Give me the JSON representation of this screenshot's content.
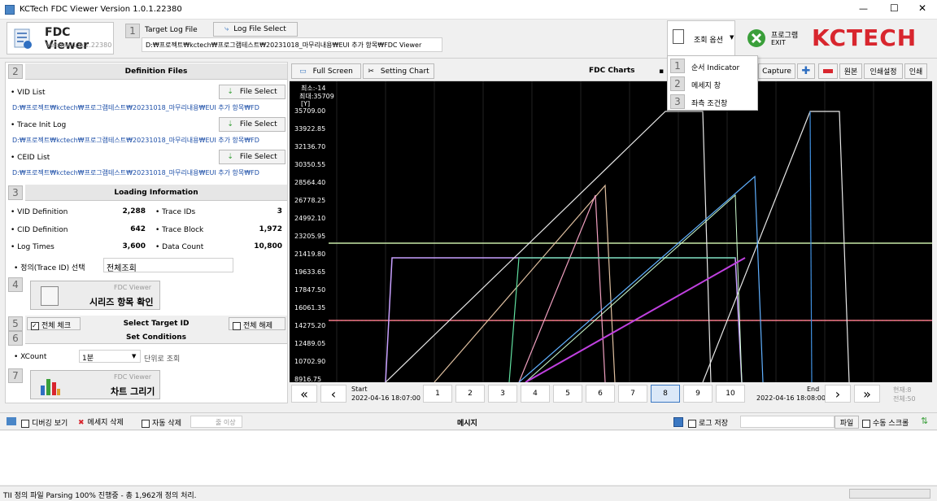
{
  "window": {
    "title": "KCTech FDC Viewer Version 1.0.1.22380",
    "controls": [
      "—",
      "☐",
      "✕"
    ]
  },
  "toolbar": {
    "app_name": "FDC Viewer",
    "app_version": "Version 1.0.1.22380",
    "target_log_label": "Target Log File",
    "log_select_label": "Log File Select",
    "log_path": "D:₩프로젝트₩kctech₩프로그램테스트₩20231018_마무리내용₩EUI 추가 항목₩FDC Viewer",
    "query_option_label": "조회 옵션",
    "exit_label_ko": "프로그램",
    "exit_label_en": "EXIT",
    "brand": "KCTECH",
    "step_num": "1"
  },
  "dropdown": {
    "items": [
      {
        "num": "1",
        "label": "순서 Indicator"
      },
      {
        "num": "2",
        "label": "메세지 창"
      },
      {
        "num": "3",
        "label": "좌측 조건창"
      }
    ]
  },
  "left": {
    "sec2": {
      "num": "2",
      "title": "Definition Files"
    },
    "vid": {
      "label": "VID List",
      "btn": "File Select",
      "path": "D:₩프로젝트₩kctech₩프로그램테스트₩20231018_마무리내용₩EUI 추가 항목₩FD"
    },
    "trace": {
      "label": "Trace Init Log",
      "btn": "File Select",
      "path": "D:₩프로젝트₩kctech₩프로그램테스트₩20231018_마무리내용₩EUI 추가 항목₩FD"
    },
    "ceid": {
      "label": "CEID List",
      "btn": "File Select",
      "path": "D:₩프로젝트₩kctech₩프로그램테스트₩20231018_마무리내용₩EUI 추가 항목₩FD"
    },
    "sec3": {
      "num": "3",
      "title": "Loading Information"
    },
    "info": {
      "vid_def_label": "VID Definition",
      "vid_def": "2,288",
      "trace_ids_label": "Trace IDs",
      "trace_ids": "3",
      "cid_def_label": "CID Definition",
      "cid_def": "642",
      "trace_block_label": "Trace Block",
      "trace_block": "1,972",
      "log_times_label": "Log Times",
      "log_times": "3,600",
      "data_count_label": "Data Count",
      "data_count": "10,800",
      "trace_sel_label": "정의(Trace ID) 선택",
      "trace_sel_value": "전체조회"
    },
    "sec4": {
      "num": "4",
      "btn_small": "FDC Viewer",
      "btn_main": "시리즈 항목 확인"
    },
    "sec5": {
      "num": "5",
      "check_all": "전체 체크",
      "title": "Select Target ID",
      "uncheck_all": "전체 해제"
    },
    "sec6": {
      "num": "6",
      "title": "Set Conditions"
    },
    "xcount": {
      "label": "XCount",
      "value": "1분",
      "suffix": "단위로 조회"
    },
    "sec7": {
      "num": "7",
      "btn_small": "FDC Viewer",
      "btn_main": "차트 그리기"
    }
  },
  "chart_toolbar": {
    "full_screen": "Full Screen",
    "setting_chart": "Setting Chart",
    "title": "FDC Charts",
    "capture": "Capture",
    "original": "원본",
    "print_setup": "인쇄설정",
    "print": "인쇄"
  },
  "chart_data": {
    "type": "line",
    "overlay_min": "최소:-14",
    "overlay_max": "최대:35709",
    "y_unit": "[Y]",
    "y_ticks": [
      "35709.00",
      "33922.85",
      "32136.70",
      "30350.55",
      "28564.40",
      "26778.25",
      "24992.10",
      "23205.95",
      "21419.80",
      "19633.65",
      "17847.50",
      "16061.35",
      "14275.20",
      "12489.05",
      "10702.90",
      "8916.75"
    ],
    "ylim": [
      8916.75,
      35709.0
    ]
  },
  "pager": {
    "start_label": "Start",
    "start_time": "2022-04-16 18:07:00",
    "end_label": "End",
    "end_time": "2022-04-16 18:08:00",
    "pages": [
      "1",
      "2",
      "3",
      "4",
      "5",
      "6",
      "7",
      "8",
      "9",
      "10"
    ],
    "current": "8",
    "page_info_1": "현재:8",
    "page_info_2": "전체:50",
    "first": "«",
    "prev": "‹",
    "next": "›",
    "last": "»"
  },
  "message_bar": {
    "debug": "디버깅 보기",
    "delete_msg": "메세지 삭제",
    "auto_delete": "자동 삭제",
    "line_count_placeholder": "줄 이상",
    "title": "메시지",
    "log_save": "로그 저장",
    "file_btn": "파일",
    "manual_scroll": "수동 스크롤"
  },
  "status": {
    "text": "TII 정의 파일 Parsing 100% 진행중 - 총 1,962개 정의 처리."
  },
  "colors": {
    "chart_bg": "#000000",
    "path_blue": "#1d4fa8",
    "brand_red": "#d8262e",
    "exit_green": "#3a9f3a"
  }
}
